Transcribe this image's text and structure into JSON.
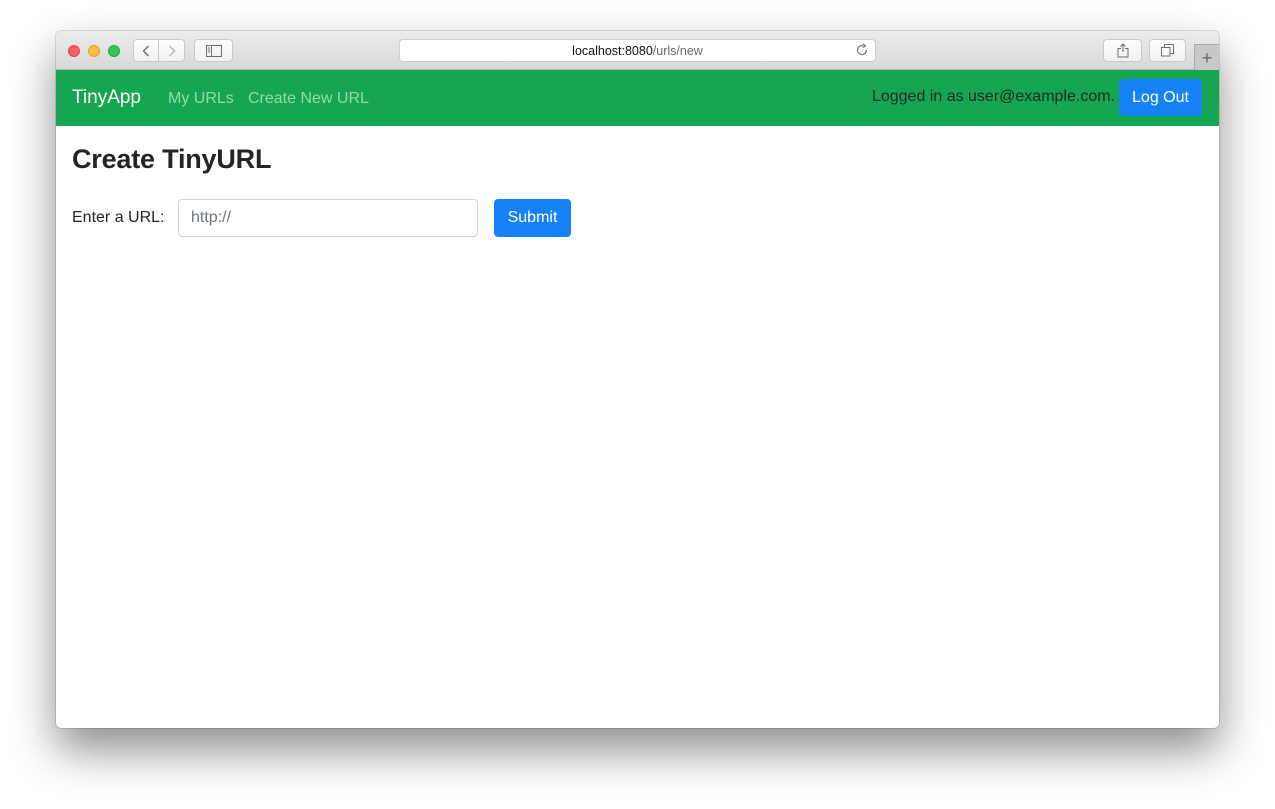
{
  "browser": {
    "address": {
      "host": "localhost:8080",
      "path": "/urls/new"
    },
    "new_tab_label": "+",
    "icons": {
      "close": "close-window-icon",
      "minimize": "minimize-window-icon",
      "zoom": "zoom-window-icon",
      "back": "chevron-left-icon",
      "forward": "chevron-right-icon",
      "sidebar": "sidebar-icon",
      "reload": "reload-icon",
      "share": "share-icon",
      "tabs": "tabs-overview-icon"
    }
  },
  "navbar": {
    "brand": "TinyApp",
    "links": [
      {
        "label": "My URLs"
      },
      {
        "label": "Create New URL"
      }
    ],
    "logged_in_text": "Logged in as user@example.com.",
    "logout_label": "Log Out",
    "color": "#16a651",
    "button_color": "#1682f6"
  },
  "main": {
    "title": "Create TinyURL",
    "form": {
      "label": "Enter a URL:",
      "input_value": "",
      "input_placeholder": "http://",
      "submit_label": "Submit"
    }
  }
}
